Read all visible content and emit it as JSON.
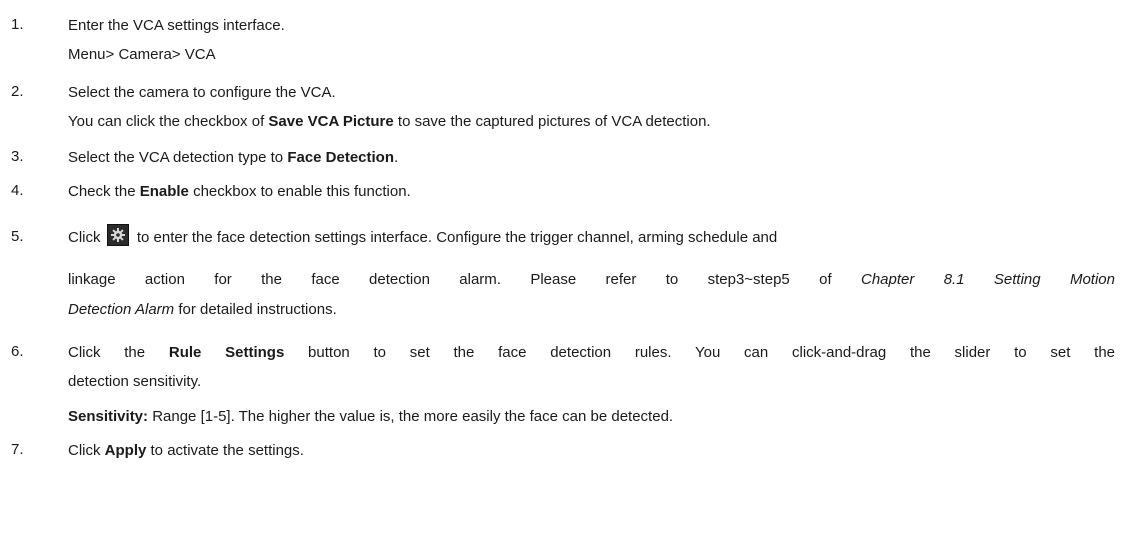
{
  "steps": [
    {
      "num": "1.",
      "lines": [
        [
          "Enter the VCA settings interface."
        ],
        [
          "Menu> Camera> VCA"
        ]
      ]
    },
    {
      "num": "2.",
      "lines": [
        [
          "Select the camera to configure the VCA."
        ],
        [
          "You can click the checkbox of ",
          "Save VCA Picture",
          " to save the captured pictures of VCA detection."
        ]
      ]
    },
    {
      "num": "3.",
      "lines": [
        [
          "Select the VCA detection type to ",
          "Face Detection",
          "."
        ]
      ]
    },
    {
      "num": "4.",
      "lines": [
        [
          "Check the ",
          "Enable",
          " checkbox to enable this function."
        ]
      ]
    },
    {
      "num": "5.",
      "lines": [
        [
          "Click",
          "to enter the face detection settings interface. Configure the trigger channel, arming schedule and"
        ],
        [
          "linkage action for the face detection alarm. Please refer to step3~step5 of ",
          "Chapter 8.1 Setting Motion"
        ],
        [
          "Detection Alarm",
          " for detailed instructions."
        ]
      ],
      "icon": "gear-icon"
    },
    {
      "num": "6.",
      "lines": [
        [
          "Click the ",
          "Rule Settings",
          " button to set the face detection rules. You can click-and-drag the slider to set the"
        ],
        [
          "detection sensitivity."
        ],
        [
          "Sensitivity:",
          " Range [1-5]. The higher the value is, the more easily the face can be detected."
        ]
      ]
    },
    {
      "num": "7.",
      "lines": [
        [
          "Click ",
          "Apply",
          " to activate the settings."
        ]
      ]
    }
  ]
}
